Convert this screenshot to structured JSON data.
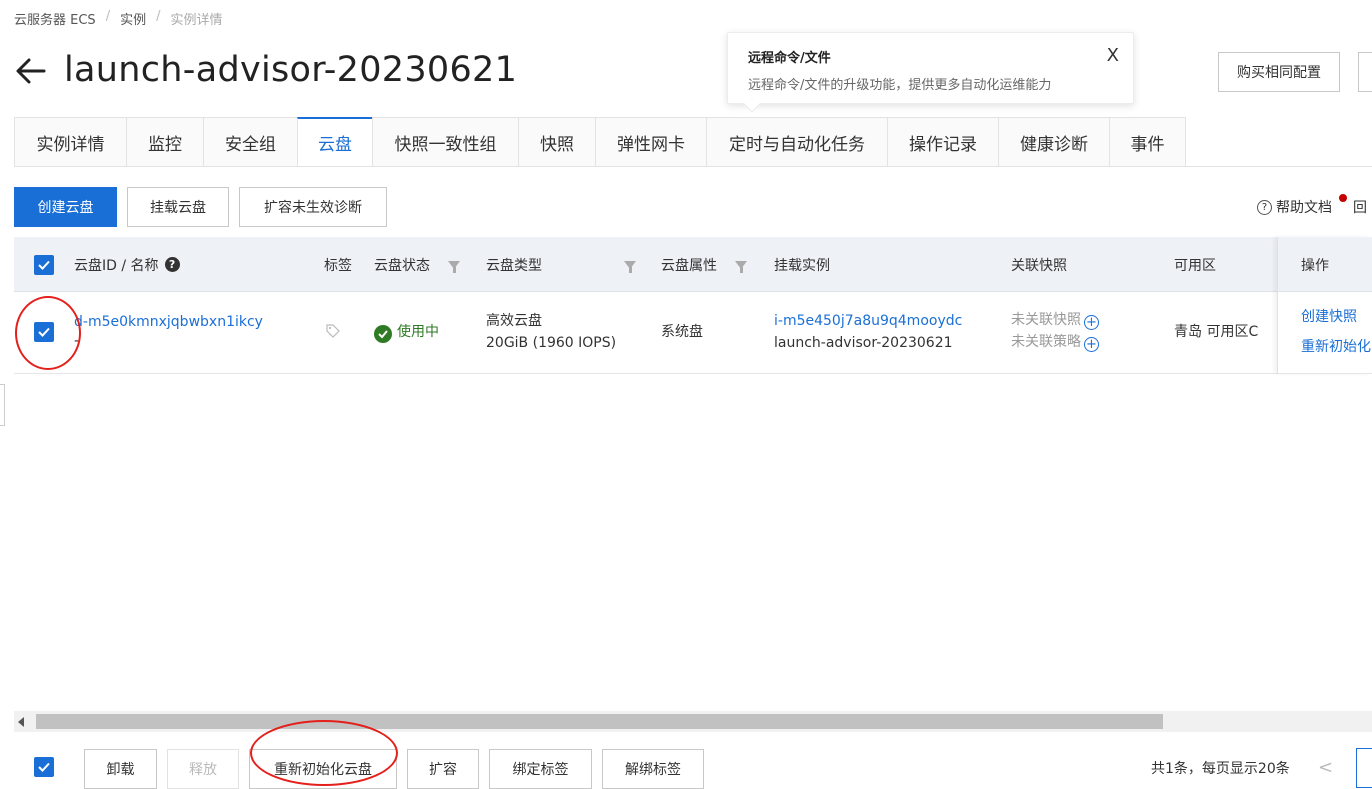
{
  "breadcrumb": [
    "云服务器 ECS",
    "实例",
    "实例详情"
  ],
  "page_title": "launch-advisor-20230621",
  "tooltip": {
    "title": "远程命令/文件",
    "desc": "远程命令/文件的升级功能，提供更多自动化运维能力",
    "close": "X"
  },
  "header_buttons": {
    "buy_same": "购买相同配置"
  },
  "tabs": [
    "实例详情",
    "监控",
    "安全组",
    "云盘",
    "快照一致性组",
    "快照",
    "弹性网卡",
    "定时与自动化任务",
    "操作记录",
    "健康诊断",
    "事件"
  ],
  "active_tab": "云盘",
  "toolbar": {
    "create": "创建云盘",
    "attach": "挂载云盘",
    "diagnose": "扩容未生效诊断",
    "help": "帮助文档",
    "help2": "回"
  },
  "table": {
    "headers": {
      "id": "云盘ID / 名称",
      "tag": "标签",
      "status": "云盘状态",
      "type": "云盘类型",
      "attr": "云盘属性",
      "instance": "挂载实例",
      "snapshot": "关联快照",
      "zone": "可用区",
      "ops": "操作"
    },
    "rows": [
      {
        "id": "d-m5e0kmnxjqbwbxn1ikcy",
        "status": "使用中",
        "type": "高效云盘",
        "type_detail": "20GiB (1960 IOPS)",
        "attr": "系统盘",
        "instance_id": "i-m5e450j7a8u9q4mooydc",
        "instance_name": "launch-advisor-20230621",
        "snap1": "未关联快照",
        "snap2": "未关联策略",
        "zone": "青岛 可用区C",
        "op1": "创建快照",
        "op2": "重新初始化"
      }
    ]
  },
  "footer": {
    "buttons": [
      "卸载",
      "释放",
      "重新初始化云盘",
      "扩容",
      "绑定标签",
      "解绑标签"
    ],
    "summary": "共1条，每页显示20条",
    "prev": "<"
  },
  "colors": {
    "primary": "#1a6fd6",
    "annotation_red": "#e3201b",
    "status_green": "#2f7a24"
  }
}
